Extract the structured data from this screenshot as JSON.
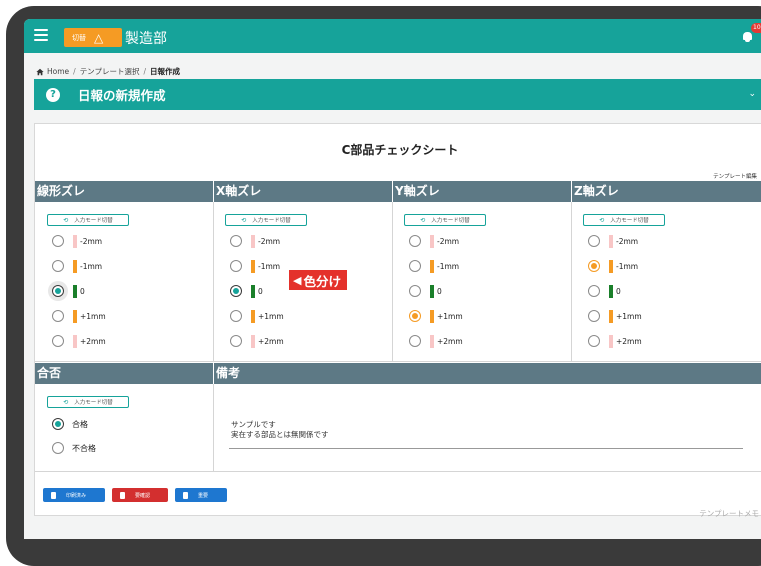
{
  "topbar": {
    "switch_label": "切替",
    "switch_icon": "warning-triangle-icon",
    "department": "製造部",
    "notification_badge": "10+",
    "accent_color": "#16a39a",
    "switch_color": "#f59b24"
  },
  "breadcrumb": {
    "home": "Home",
    "sep1": "/",
    "template_select": "テンプレート選択",
    "sep2": "/",
    "current": "日報作成"
  },
  "title_bar": {
    "help_icon": "?",
    "title": "日報の新規作成",
    "chevron": "⌄"
  },
  "sheet": {
    "title": "C部品チェックシート",
    "template_edit": "テンプレート編集",
    "mode_switch_label": "入力モード切替",
    "columns": [
      {
        "header": "線形ズレ",
        "selected": "0",
        "options": [
          {
            "label": "-2mm",
            "color": "#f8c6c6"
          },
          {
            "label": "-1mm",
            "color": "#f59b24"
          },
          {
            "label": "0",
            "color": "#1a7f2a"
          },
          {
            "label": "+1mm",
            "color": "#f59b24"
          },
          {
            "label": "+2mm",
            "color": "#f8c6c6"
          }
        ]
      },
      {
        "header": "X軸ズレ",
        "selected": "0",
        "options": [
          {
            "label": "-2mm",
            "color": "#f8c6c6"
          },
          {
            "label": "-1mm",
            "color": "#f59b24"
          },
          {
            "label": "0",
            "color": "#1a7f2a"
          },
          {
            "label": "+1mm",
            "color": "#f59b24"
          },
          {
            "label": "+2mm",
            "color": "#f8c6c6"
          }
        ]
      },
      {
        "header": "Y軸ズレ",
        "selected": "+1mm",
        "options": [
          {
            "label": "-2mm",
            "color": "#f8c6c6"
          },
          {
            "label": "-1mm",
            "color": "#f59b24"
          },
          {
            "label": "0",
            "color": "#1a7f2a"
          },
          {
            "label": "+1mm",
            "color": "#f59b24"
          },
          {
            "label": "+2mm",
            "color": "#f8c6c6"
          }
        ]
      },
      {
        "header": "Z軸ズレ",
        "selected": "-1mm",
        "options": [
          {
            "label": "-2mm",
            "color": "#f8c6c6"
          },
          {
            "label": "-1mm",
            "color": "#f59b24"
          },
          {
            "label": "0",
            "color": "#1a7f2a"
          },
          {
            "label": "+1mm",
            "color": "#f59b24"
          },
          {
            "label": "+2mm",
            "color": "#f8c6c6"
          }
        ]
      }
    ],
    "callout": "色分け",
    "pass_header": "合否",
    "pass_options": [
      "合格",
      "不合格"
    ],
    "pass_selected": "合格",
    "remarks_header": "備考",
    "remarks_line1": "サンプルです",
    "remarks_line2": "実在する部品とは無関係です",
    "buttons": [
      {
        "label": "印刷済み",
        "color": "#1e77d0"
      },
      {
        "label": "要確認",
        "color": "#d32f2f"
      },
      {
        "label": "重要",
        "color": "#1e77d0"
      }
    ],
    "template_memo": "テンプレートメモ",
    "header_color": "#5d7985"
  }
}
